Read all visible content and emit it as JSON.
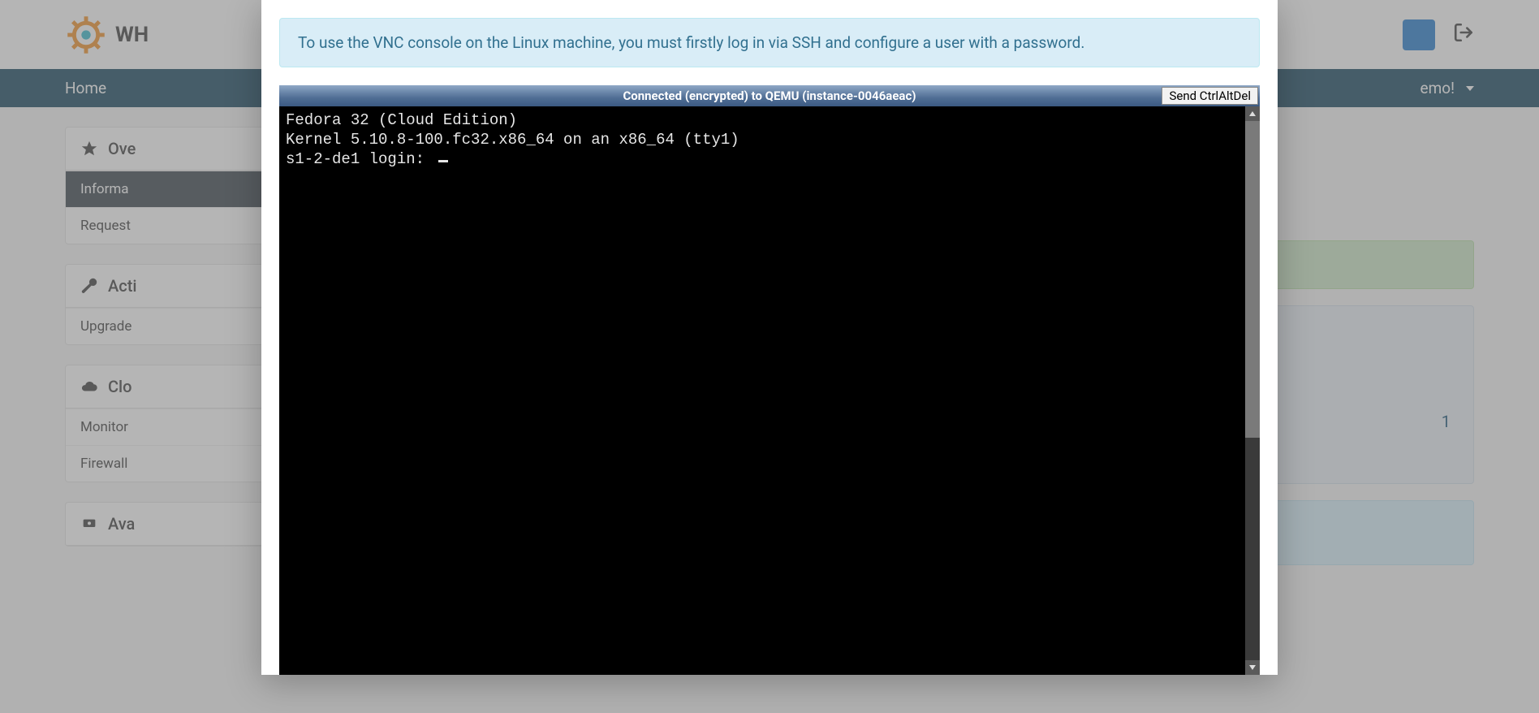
{
  "logo_text": "WH",
  "nav": {
    "home": "Home",
    "right_label": "emo!"
  },
  "sidebar": {
    "overview": {
      "title": "Ove",
      "items": [
        "Informa",
        "Request"
      ]
    },
    "actions": {
      "title": "Acti",
      "items": [
        "Upgrade"
      ]
    },
    "cloud": {
      "title": "Clo",
      "items": [
        "Monitor",
        "Firewall"
      ]
    },
    "avail": {
      "title": "Ava"
    }
  },
  "main": {
    "right_number": "1"
  },
  "modal": {
    "alert": "To use the VNC console on the Linux machine, you must firstly log in via SSH and configure a user with a password.",
    "vnc_status": "Connected (encrypted) to QEMU (instance-0046aeac)",
    "cad_button": "Send CtrlAltDel",
    "terminal_lines": [
      "Fedora 32 (Cloud Edition)",
      "Kernel 5.10.8-100.fc32.x86_64 on an x86_64 (tty1)",
      "",
      "s1-2-de1 login: "
    ]
  }
}
